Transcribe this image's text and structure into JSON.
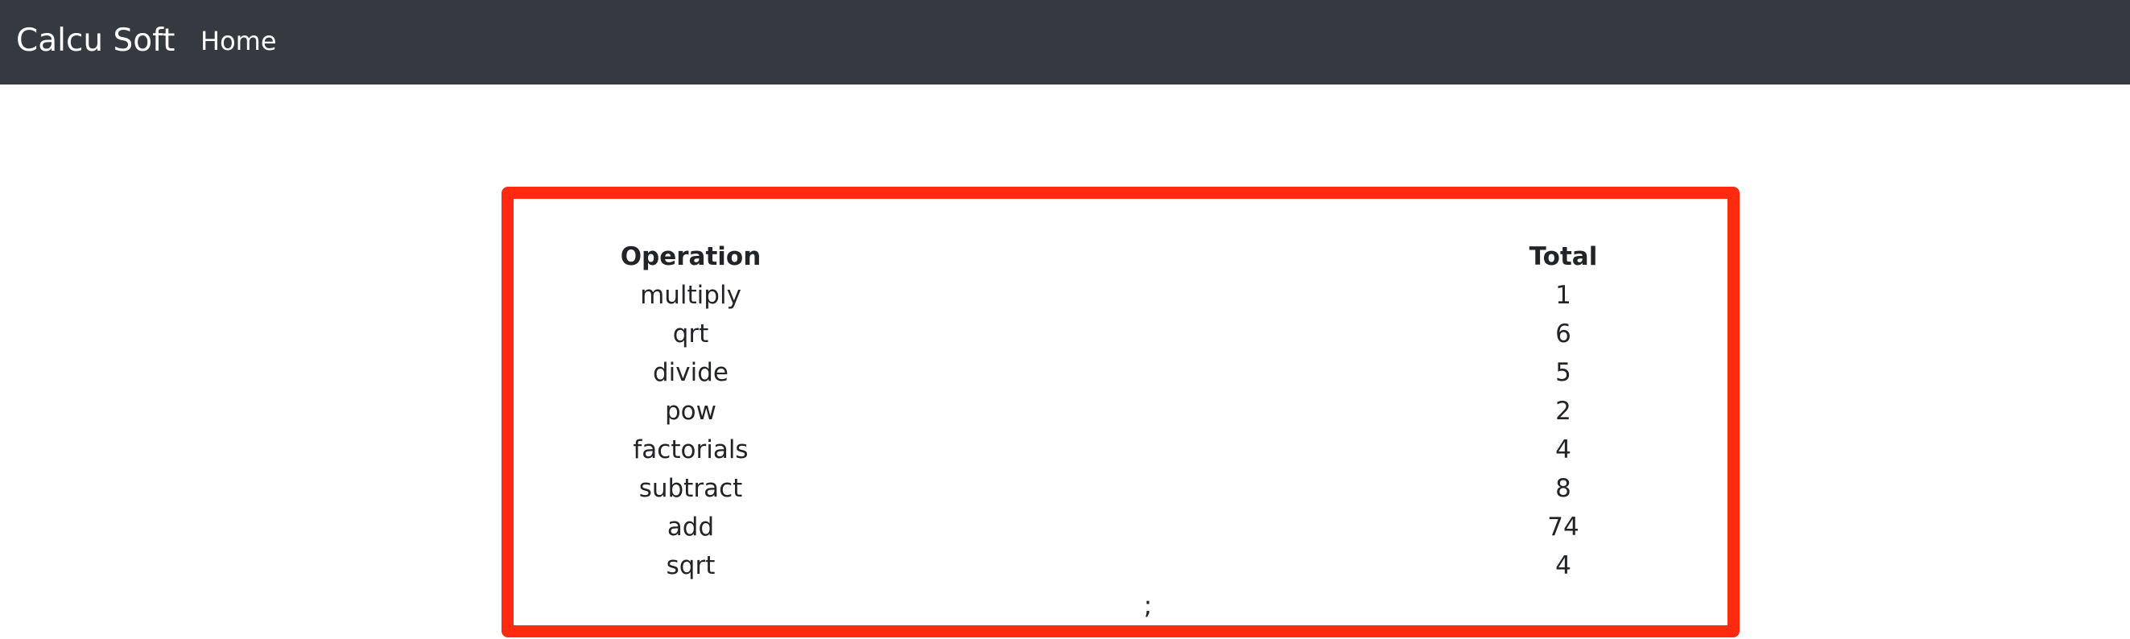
{
  "navbar": {
    "brand": "Calcu Soft",
    "home_label": "Home"
  },
  "table": {
    "headers": {
      "operation": "Operation",
      "total": "Total"
    },
    "rows": [
      {
        "operation": "multiply",
        "total": "1"
      },
      {
        "operation": "qrt",
        "total": "6"
      },
      {
        "operation": "divide",
        "total": "5"
      },
      {
        "operation": "pow",
        "total": "2"
      },
      {
        "operation": "factorials",
        "total": "4"
      },
      {
        "operation": "subtract",
        "total": "8"
      },
      {
        "operation": "add",
        "total": "74"
      },
      {
        "operation": "sqrt",
        "total": "4"
      }
    ],
    "trailing_text": ";"
  },
  "colors": {
    "navbar_bg": "#343a40",
    "highlight_border": "#ff2a10",
    "text": "#212529"
  }
}
